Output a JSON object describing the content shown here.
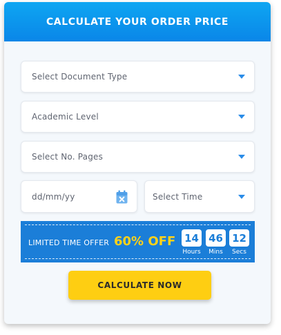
{
  "header": {
    "title": "CALCULATE YOUR ORDER PRICE"
  },
  "form": {
    "document_type": {
      "placeholder": "Select Document Type"
    },
    "academic_level": {
      "placeholder": "Academic Level"
    },
    "pages": {
      "placeholder": "Select No. Pages"
    },
    "date": {
      "placeholder": "dd/mm/yy",
      "icon": "calendar-icon"
    },
    "time": {
      "placeholder": "Select Time"
    }
  },
  "offer": {
    "label": "LIMITED TIME OFFER",
    "discount": "60% OFF",
    "countdown": [
      {
        "value": "14",
        "caption": "Hours"
      },
      {
        "value": "46",
        "caption": "Mins"
      },
      {
        "value": "12",
        "caption": "Secs"
      }
    ]
  },
  "button": {
    "label": "CALCULATE NOW"
  },
  "colors": {
    "header": "#0a86e8",
    "accent": "#2a8ce8",
    "offer_banner": "#1b7ed8",
    "offer_highlight": "#ffd21a",
    "button": "#fece12"
  }
}
